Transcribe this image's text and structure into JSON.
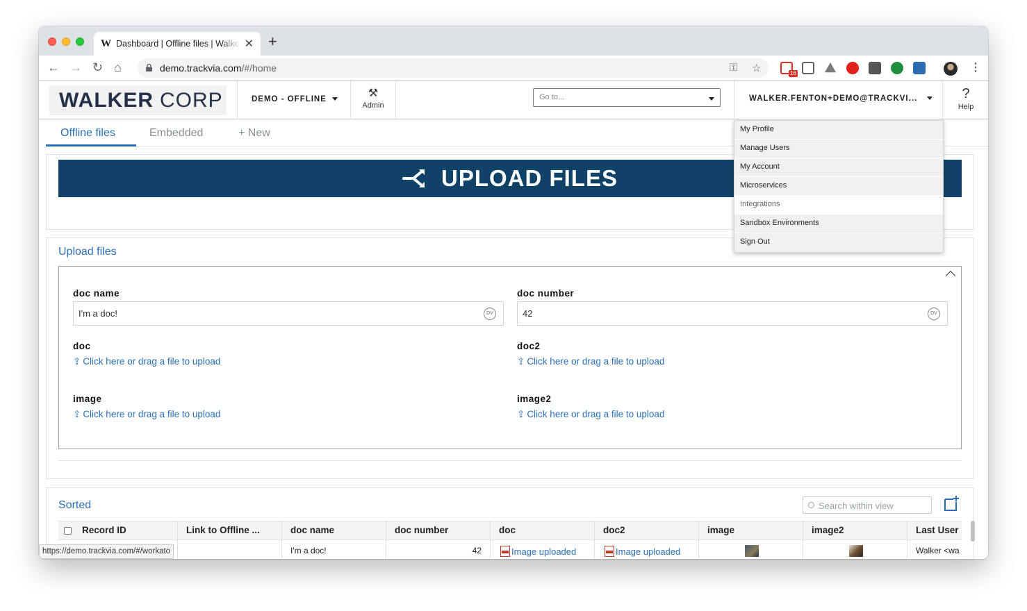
{
  "browser": {
    "tab_favicon": "W",
    "tab_title": "Dashboard | Offline files | Walker Corp",
    "url_host": "demo.trackvia.com",
    "url_path": "/#/home",
    "gmail_badge": "16",
    "status_url": "https://demo.trackvia.com/#/workato"
  },
  "header": {
    "logo_bold": "WALKER",
    "logo_light": "CORP",
    "app_switcher": "DEMO - OFFLINE",
    "admin_label": "Admin",
    "goto_placeholder": "Go to...",
    "user": "WALKER.FENTON+DEMO@TRACKVI...",
    "help_label": "Help"
  },
  "page_tabs": [
    {
      "label": "Offline files",
      "active": true
    },
    {
      "label": "Embedded",
      "active": false
    },
    {
      "label": "+ New",
      "active": false
    }
  ],
  "banner": {
    "label": "UPLOAD FILES",
    "bg_color": "#0f4266"
  },
  "upload_form": {
    "title": "Upload files",
    "fields": {
      "doc_name": {
        "label": "doc name",
        "value": "I'm a doc!",
        "badge": "DV"
      },
      "doc_number": {
        "label": "doc number",
        "value": "42",
        "badge": "DV"
      },
      "doc": {
        "label": "doc",
        "link": "Click here or drag a file to upload"
      },
      "doc2": {
        "label": "doc2",
        "link": "Click here or drag a file to upload"
      },
      "image": {
        "label": "image",
        "link": "Click here or drag a file to upload"
      },
      "image2": {
        "label": "image2",
        "link": "Click here or drag a file to upload"
      }
    }
  },
  "sorted_view": {
    "title": "Sorted",
    "search_placeholder": "Search within view",
    "columns": [
      "Record ID",
      "Link to Offline ...",
      "doc name",
      "doc number",
      "doc",
      "doc2",
      "image",
      "image2",
      "Last User"
    ],
    "rows": [
      {
        "record_id": "",
        "link": "",
        "doc_name": "I'm a doc!",
        "doc_number": "42",
        "doc": "Image uploaded",
        "doc2": "Image uploaded",
        "last_user": "Walker <wa"
      }
    ]
  },
  "user_dropdown": {
    "items": [
      "My Profile",
      "Manage Users",
      "My Account",
      "Microservices",
      "Integrations",
      "Sandbox Environments",
      "Sign Out"
    ],
    "hovered": "Integrations"
  },
  "colors": {
    "accent": "#2a6fb5",
    "banner": "#0f4266",
    "logo": "#23304a"
  }
}
